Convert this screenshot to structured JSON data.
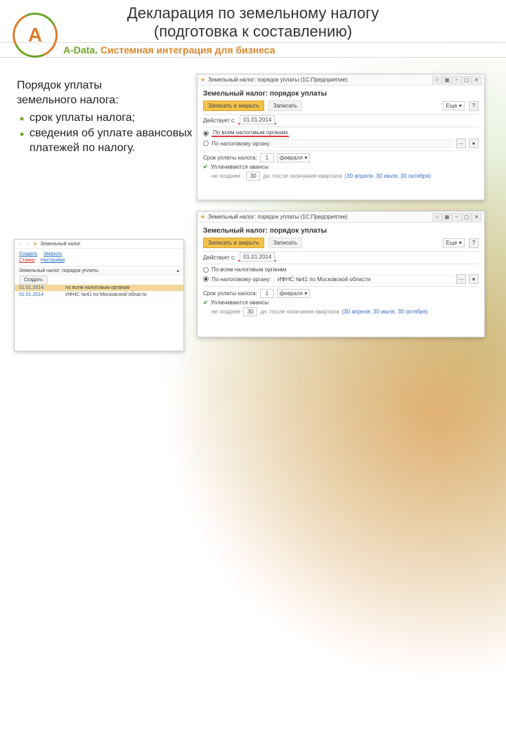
{
  "header": {
    "title1": "Декларация по земельному налогу",
    "title2": "(подготовка к составлению)",
    "sub_a": "A-Data.",
    "sub_b": " Системная интеграция для бизнеса"
  },
  "logo_letter": "A",
  "left_text": {
    "heading1": "Порядок уплаты",
    "heading2": "земельного налога:",
    "items": [
      "срок уплаты налога;",
      "сведения об уплате авансовых платежей по налогу."
    ]
  },
  "win1": {
    "tb_title": "Земельный налог: порядок уплаты (1С:Предприятие)",
    "big_head": "Земельный налог: порядок уплаты",
    "btn_save_close": "Записать и закрыть",
    "btn_save": "Записать",
    "field_more": "Еще",
    "q_label": "?",
    "effective_label": "Действует с:",
    "effective_date": "01.01.2014",
    "radio_all": "По всем налоговым органам",
    "radio_one": "По налоговому органу:",
    "due_label": "Срок уплаты налога:",
    "due_month": "1",
    "due_month_name": "февраля",
    "advance_label": "Уплачиваются авансы",
    "advance_due": "не позднее",
    "advance_days": "30",
    "advance_tail": "дн. после окончания квартала",
    "advance_note": "(30 апреля, 30 июля, 30 октября)"
  },
  "win2": {
    "tb_title": "Земельный налог: порядок уплаты (1С:Предприятие)",
    "big_head": "Земельный налог: порядок уплаты",
    "btn_save_close": "Записать и закрыть",
    "btn_save": "Записать",
    "field_more": "Еще",
    "q_label": "?",
    "effective_label": "Действует с:",
    "effective_date": "01.01.2014",
    "radio_all": "По всем налоговым органам",
    "radio_one": "По налоговому органу:",
    "ifns_value": "ИФНС №41 по Московской области",
    "due_label": "Срок уплаты налога:",
    "due_month": "1",
    "due_month_name": "февраля",
    "advance_label": "Уплачиваются авансы",
    "advance_due": "не позднее",
    "advance_days": "30",
    "advance_tail": "дн. после окончания квартала",
    "advance_note": "(30 апреля, 30 июля, 30 октября)"
  },
  "win3": {
    "crumb": "Земельный налог",
    "tabs": {
      "link1": "Создать",
      "link2": "Закрыть",
      "link3": "Настройки",
      "active": "Ставки"
    },
    "section": "Земельный налог: порядок уплаты",
    "btn_create": "Создать",
    "grid": [
      {
        "c1": "01.01.2014",
        "c2": "по всем налоговым органам"
      },
      {
        "c1": "01.01.2014",
        "c2": "ИФНС №41 по Московской области"
      }
    ]
  }
}
